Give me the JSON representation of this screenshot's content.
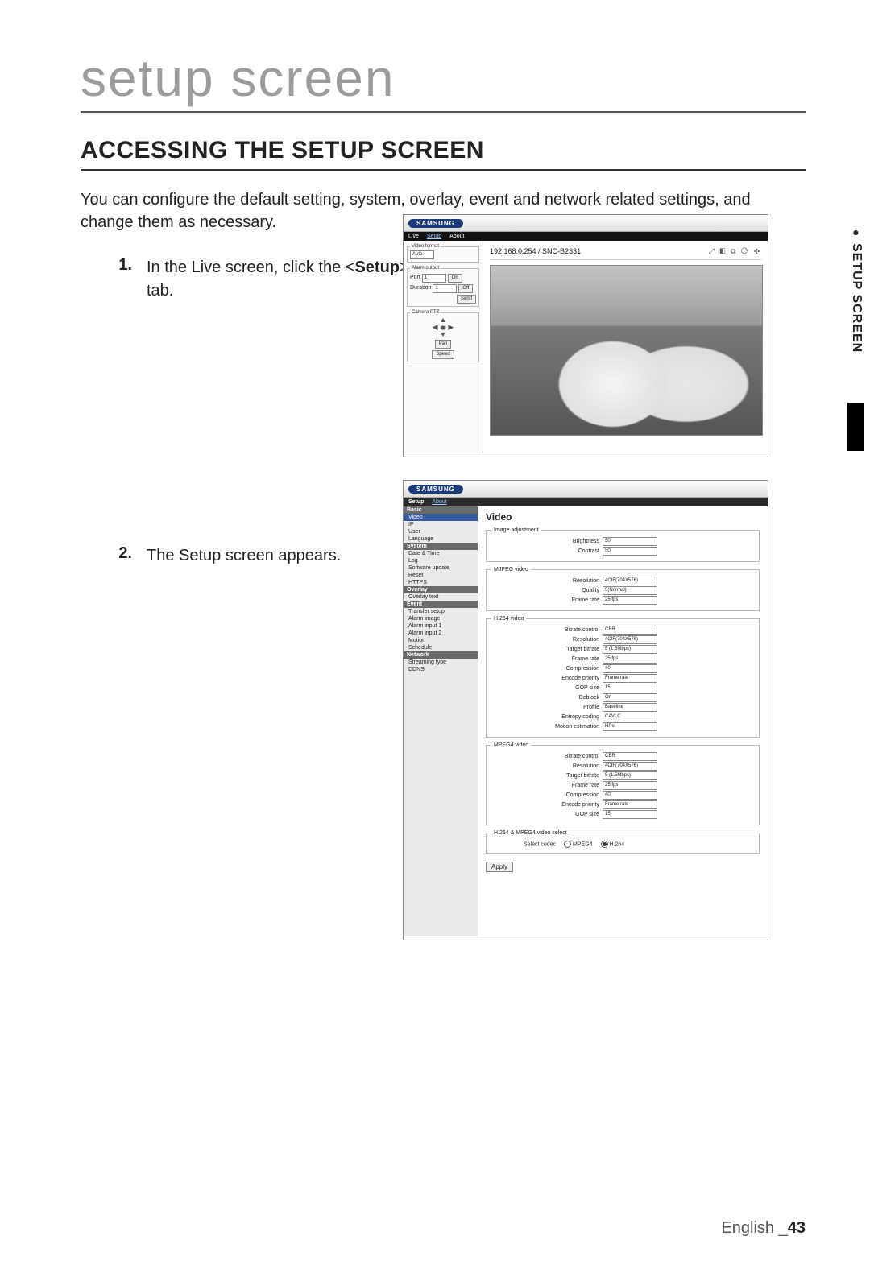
{
  "chapter_title": "setup screen",
  "section_title": "ACCESSING THE SETUP SCREEN",
  "intro": "You can configure the default setting, system, overlay, event and network related settings, and change them as necessary.",
  "side_tab": "SETUP SCREEN",
  "steps": {
    "s1_num": "1.",
    "s1_pre": "In the Live screen, click the <",
    "s1_bold": "Setup",
    "s1_post": "> tab.",
    "s2_num": "2.",
    "s2_text": "The Setup screen appears."
  },
  "shot1": {
    "brand": "SAMSUNG",
    "tabs": {
      "live": "Live",
      "setup": "Setup",
      "about": "About"
    },
    "video_format": {
      "legend": "Video format",
      "value": "Auto"
    },
    "alarm_output": {
      "legend": "Alarm output",
      "port": "Port",
      "port_val": "1",
      "on": "On",
      "off": "Off",
      "duration": "Duration",
      "dur_val": "1",
      "send": "Send"
    },
    "ptz": {
      "legend": "Camera PTZ",
      "pan": "Pan",
      "speed": "Speed"
    },
    "view_title": "192.168.0.254 / SNC-B2331",
    "view_icons": "⤢ ◧ ⧉ ⟳ ✣"
  },
  "shot2": {
    "brand": "SAMSUNG",
    "tabs": {
      "setup": "Setup",
      "about": "About"
    },
    "nav": {
      "basic": "Basic",
      "basic_items": [
        "Video",
        "IP",
        "User",
        "Language"
      ],
      "system": "System",
      "system_items": [
        "Date & Time",
        "Log",
        "Software update",
        "Reset",
        "HTTPS"
      ],
      "overlay": "Overlay",
      "overlay_items": [
        "Overlay text"
      ],
      "event": "Event",
      "event_items": [
        "Transfer setup",
        "Alarm image",
        "Alarm input 1",
        "Alarm input 2",
        "Motion",
        "Schedule"
      ],
      "network": "Network",
      "network_items": [
        "Streaming type",
        "DDNS"
      ]
    },
    "title": "Video",
    "image_adj": {
      "legend": "Image adjustment",
      "brightness": "Brightness",
      "brightness_val": "50",
      "contrast": "Contrast",
      "contrast_val": "50"
    },
    "mjpeg": {
      "legend": "MJPEG video",
      "resolution": "Resolution",
      "resolution_val": "4CIF(704X576)",
      "quality": "Quality",
      "quality_val": "5(Normal)",
      "framerate": "Frame rate",
      "framerate_val": "25 fps"
    },
    "h264": {
      "legend": "H.264 video",
      "bitrate_ctrl": "Bitrate control",
      "bitrate_ctrl_val": "CBR",
      "resolution": "Resolution",
      "resolution_val": "4CIF(704X576)",
      "target_bitrate": "Target bitrate",
      "target_bitrate_val": "5 (1.5Mbps)",
      "framerate": "Frame rate",
      "framerate_val": "25 fps",
      "compression": "Compression",
      "compression_val": "40",
      "encode_priority": "Encode priority",
      "encode_priority_val": "Frame rate",
      "gop": "GOP size",
      "gop_val": "15",
      "deblock": "Deblock",
      "deblock_val": "On",
      "profile": "Profile",
      "profile_val": "Baseline",
      "entropy": "Entropy coding",
      "entropy_val": "CAVLC",
      "motion_est": "Motion estimation",
      "motion_est_val": "HPel"
    },
    "mpeg4": {
      "legend": "MPEG4 video",
      "bitrate_ctrl": "Bitrate control",
      "bitrate_ctrl_val": "CBR",
      "resolution": "Resolution",
      "resolution_val": "4CIF(704X576)",
      "target_bitrate": "Target bitrate",
      "target_bitrate_val": "5 (1.5Mbps)",
      "framerate": "Frame rate",
      "framerate_val": "25 fps",
      "compression": "Compression",
      "compression_val": "40",
      "encode_priority": "Encode priority",
      "encode_priority_val": "Frame rate",
      "gop": "GOP size",
      "gop_val": "15"
    },
    "codec_select": {
      "legend": "H.264 & MPEG4 video select",
      "label": "Select codec",
      "opt1": "MPEG4",
      "opt2": "H.264"
    },
    "apply": "Apply"
  },
  "footer": {
    "lang": "English",
    "sep": "_",
    "page": "43"
  }
}
